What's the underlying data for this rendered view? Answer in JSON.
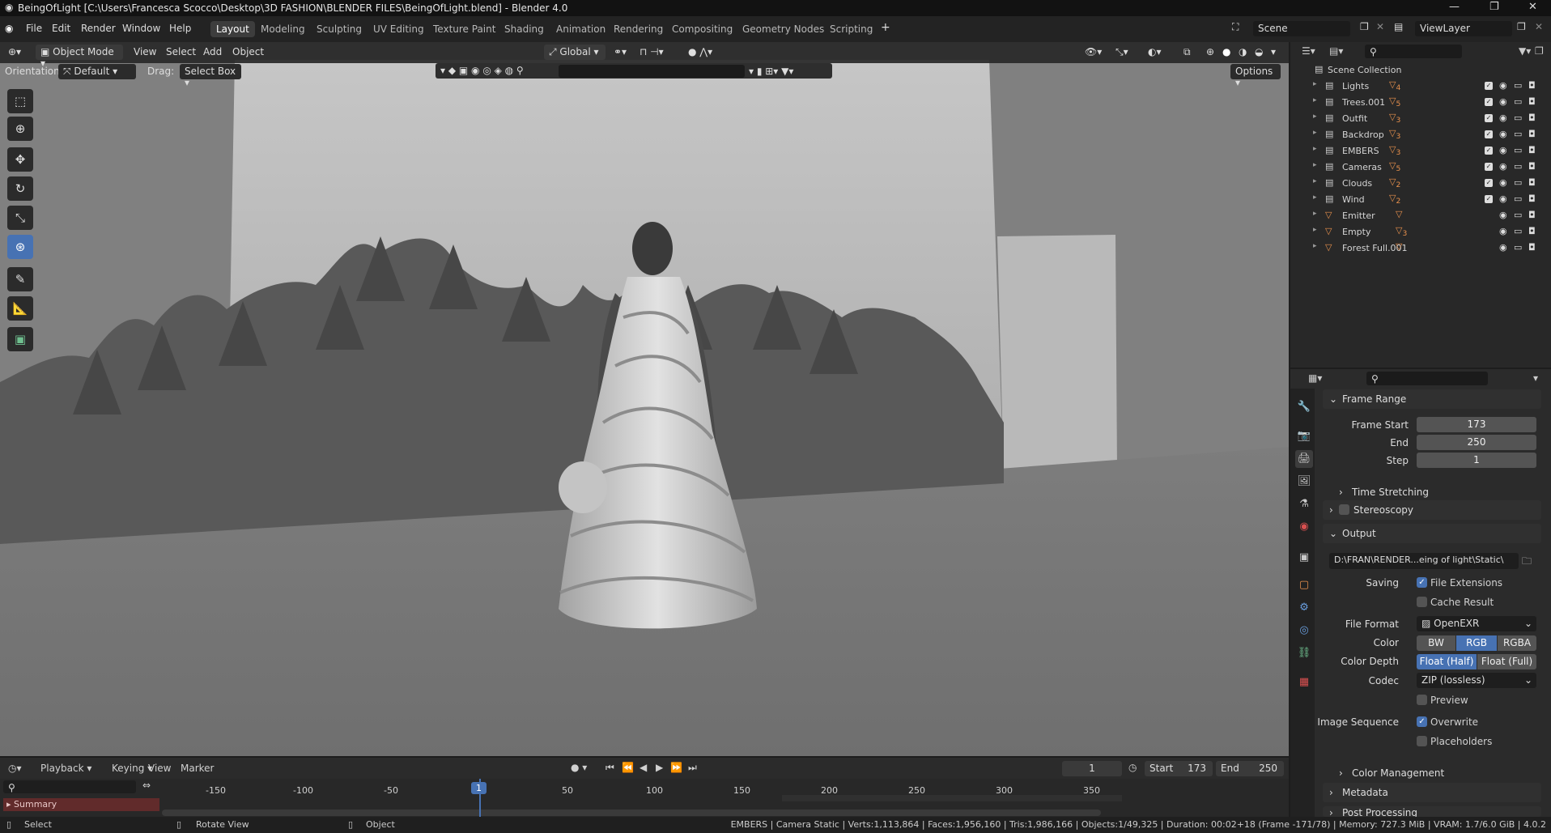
{
  "title_bar": {
    "title": "BeingOfLight [C:\\Users\\Francesca Scocco\\Desktop\\3D FASHION\\BLENDER FILES\\BeingOfLight.blend] - Blender 4.0"
  },
  "menu": [
    "File",
    "Edit",
    "Render",
    "Window",
    "Help"
  ],
  "workspaces": [
    "Layout",
    "Modeling",
    "Sculpting",
    "UV Editing",
    "Texture Paint",
    "Shading",
    "Animation",
    "Rendering",
    "Compositing",
    "Geometry Nodes",
    "Scripting"
  ],
  "scene": "Scene",
  "view_layer": "ViewLayer",
  "viewport": {
    "mode": "Object Mode",
    "menus": [
      "View",
      "Select",
      "Add",
      "Object"
    ],
    "transform": "Global",
    "orientation_label": "Orientation:",
    "orientation": "Default",
    "drag_label": "Drag:",
    "drag": "Select Box",
    "options": "Options"
  },
  "outliner": {
    "root": "Scene Collection",
    "items": [
      {
        "name": "Lights",
        "badge": "4"
      },
      {
        "name": "Trees.001",
        "badge": "5"
      },
      {
        "name": "Outfit",
        "badge": "3"
      },
      {
        "name": "Backdrop",
        "badge": "3"
      },
      {
        "name": "EMBERS",
        "badge": "3"
      },
      {
        "name": "Cameras",
        "badge": "5"
      },
      {
        "name": "Clouds",
        "badge": "2"
      },
      {
        "name": "Wind",
        "badge": "2"
      },
      {
        "name": "Emitter",
        "badge": ""
      },
      {
        "name": "Empty",
        "badge": "3"
      },
      {
        "name": "Forest Full.001",
        "badge": ""
      }
    ]
  },
  "properties": {
    "frame_range": "Frame Range",
    "frame_start_label": "Frame Start",
    "frame_start": "173",
    "end_label": "End",
    "end": "250",
    "step_label": "Step",
    "step": "1",
    "time_stretching": "Time Stretching",
    "stereoscopy": "Stereoscopy",
    "output": "Output",
    "output_path": "D:\\FRAN\\RENDER...eing of light\\Static\\",
    "saving_label": "Saving",
    "file_extensions": "File Extensions",
    "cache_result": "Cache Result",
    "file_format_label": "File Format",
    "file_format": "OpenEXR",
    "color_label": "Color",
    "color_opts": [
      "BW",
      "RGB",
      "RGBA"
    ],
    "color_depth_label": "Color Depth",
    "depth_opts": [
      "Float (Half)",
      "Float (Full)"
    ],
    "codec_label": "Codec",
    "codec": "ZIP (lossless)",
    "preview": "Preview",
    "image_sequence_label": "Image Sequence",
    "overwrite": "Overwrite",
    "placeholders": "Placeholders",
    "color_management": "Color Management",
    "metadata": "Metadata",
    "post_processing": "Post Processing"
  },
  "timeline": {
    "menus": [
      "Playback",
      "Keying",
      "View",
      "Marker"
    ],
    "current_frame": "1",
    "start_label": "Start",
    "start": "173",
    "end_label": "End",
    "end": "250",
    "ticks": [
      "-150",
      "-100",
      "-50",
      "1",
      "50",
      "100",
      "150",
      "200",
      "250",
      "300",
      "350"
    ],
    "summary": "Summary"
  },
  "status": {
    "select": "Select",
    "rotate": "Rotate View",
    "object": "Object",
    "info": "EMBERS | Camera Static | Verts:1,113,864 | Faces:1,956,160 | Tris:1,986,166 | Objects:1/49,325 | Duration: 00:02+18 (Frame -171/78) | Memory: 727.3 MiB | VRAM: 1.7/6.0 GiB | 4.0.2"
  }
}
